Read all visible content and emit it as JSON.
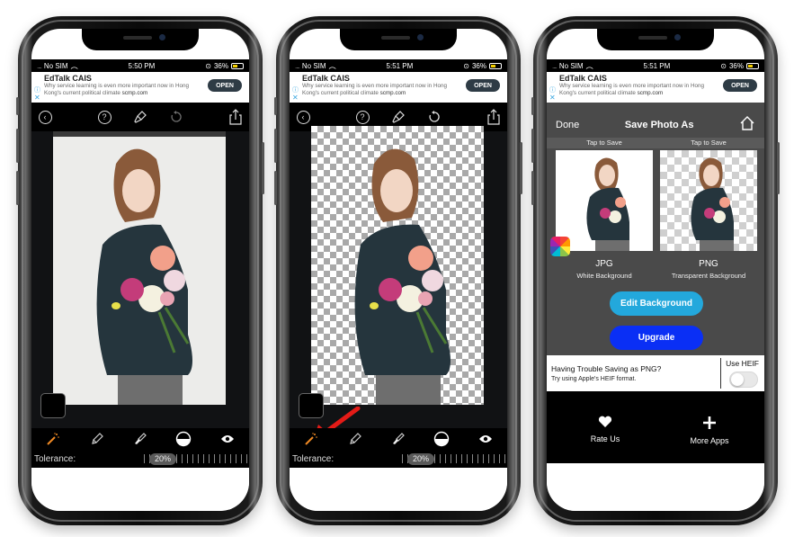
{
  "status_bar": {
    "carrier": "No SIM",
    "battery": "36%",
    "times": [
      "5:50 PM",
      "5:51 PM",
      "5:51 PM"
    ]
  },
  "ad": {
    "title": "EdTalk CAIS",
    "text": "Why service learning is even more important now in Hong Kong's current political climate",
    "domain": "scmp.com",
    "button": "OPEN"
  },
  "editor": {
    "tolerance_label": "Tolerance:",
    "tolerance_value": "20%",
    "tolerance_percent": 20,
    "toolbar_icons": [
      "back-icon",
      "help-icon",
      "brush-icon",
      "undo-icon",
      "share-icon"
    ],
    "tools": [
      "magic-wand-icon",
      "eraser-icon",
      "restore-brush-icon",
      "contrast-icon",
      "eye-icon"
    ],
    "active_tool": "magic-wand-icon",
    "accent_color": "#f08a24"
  },
  "save_screen": {
    "done": "Done",
    "title": "Save Photo As",
    "tap_to_save": "Tap to Save",
    "options": [
      {
        "format": "JPG",
        "desc": "White Background"
      },
      {
        "format": "PNG",
        "desc": "Transparent Background"
      }
    ],
    "edit_background": "Edit Background",
    "upgrade": "Upgrade",
    "heif_title": "Having Trouble Saving as PNG?",
    "heif_sub": "Try using Apple's HEIF format.",
    "heif_label": "Use HEIF",
    "heif_enabled": false,
    "rate_us": "Rate Us",
    "more_apps": "More Apps",
    "edit_bg_color": "#23a8dc",
    "upgrade_color": "#0a2ff5"
  }
}
